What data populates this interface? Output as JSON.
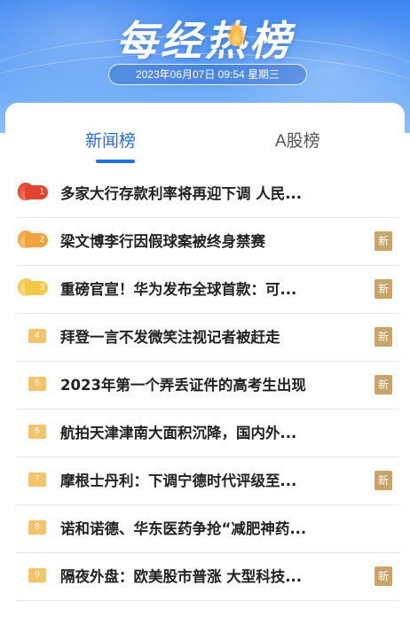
{
  "header": {
    "logo_text": "每经热榜",
    "date_text": "2023年06月07日 09:54 星期三"
  },
  "tabs": [
    {
      "label": "新闻榜",
      "active": true
    },
    {
      "label": "A股榜",
      "active": false
    }
  ],
  "news": [
    {
      "rank": "1",
      "title": "多家大行存款利率将再迎下调 人民...",
      "new": false
    },
    {
      "rank": "2",
      "title": "梁文博李行因假球案被终身禁赛",
      "new": true
    },
    {
      "rank": "3",
      "title": "重磅官宣！华为发布全球首款：可...",
      "new": true
    },
    {
      "rank": "4",
      "title": "拜登一言不发微笑注视记者被赶走",
      "new": true
    },
    {
      "rank": "5",
      "title": "2023年第一个弄丢证件的高考生出现",
      "new": true
    },
    {
      "rank": "6",
      "title": "航拍天津津南大面积沉降，国内外...",
      "new": false
    },
    {
      "rank": "7",
      "title": "摩根士丹利：下调宁德时代评级至...",
      "new": true
    },
    {
      "rank": "8",
      "title": "诺和诺德、华东医药争抢“减肥神药...",
      "new": false
    },
    {
      "rank": "9",
      "title": "隔夜外盘：欧美股市普涨 大型科技...",
      "new": true
    }
  ],
  "badge_label": "新",
  "colors": {
    "accent": "#1f6fe0",
    "rank1": "#e2442f",
    "rank2": "#f2a23c",
    "rank3": "#f6c84a",
    "badge": "#c6a46a"
  }
}
